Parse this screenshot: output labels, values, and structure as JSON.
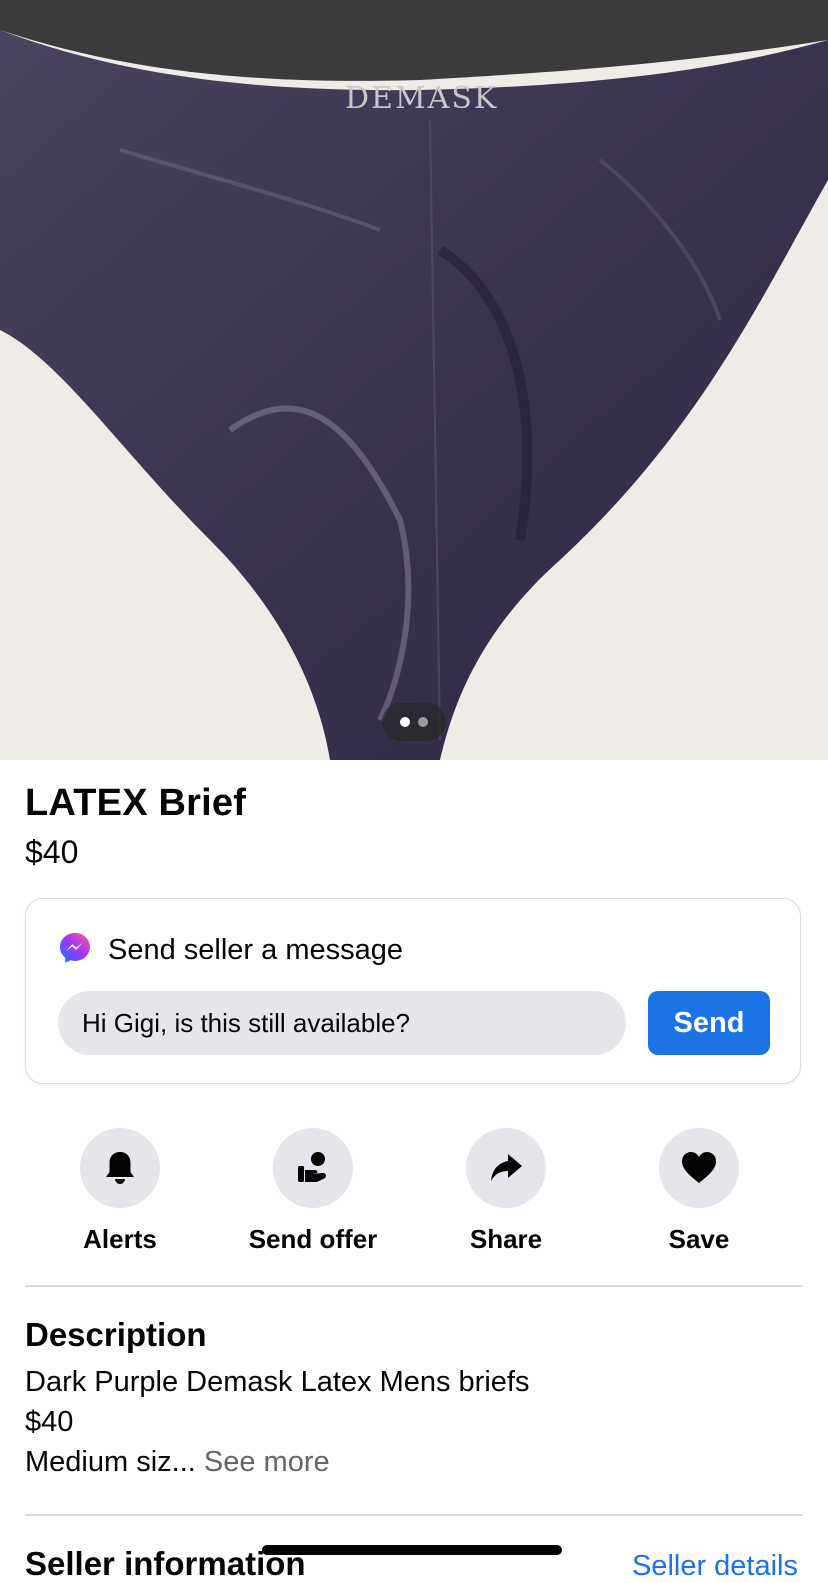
{
  "listing": {
    "image_alt": "Dark purple latex brief",
    "brand_mark": "DEMASK",
    "pager": {
      "total": 2,
      "active": 1
    },
    "title": "LATEX Brief",
    "price": "$40"
  },
  "message": {
    "heading": "Send seller a message",
    "input_value": "Hi Gigi, is this still available?",
    "send_label": "Send"
  },
  "actions": [
    {
      "label": "Alerts",
      "icon": "bell-icon"
    },
    {
      "label": "Send offer",
      "icon": "offer-hand-icon"
    },
    {
      "label": "Share",
      "icon": "share-arrow-icon"
    },
    {
      "label": "Save",
      "icon": "heart-icon"
    }
  ],
  "description": {
    "heading": "Description",
    "lines": [
      "Dark Purple Demask Latex Mens briefs",
      "$40",
      "Medium siz..."
    ],
    "see_more": "See more"
  },
  "seller": {
    "heading": "Seller information",
    "link": "Seller details"
  },
  "colors": {
    "accent": "#1b74e4",
    "chip_bg": "#e4e6eb",
    "photo_bg": "#efece7",
    "garment": "#3f3852"
  }
}
